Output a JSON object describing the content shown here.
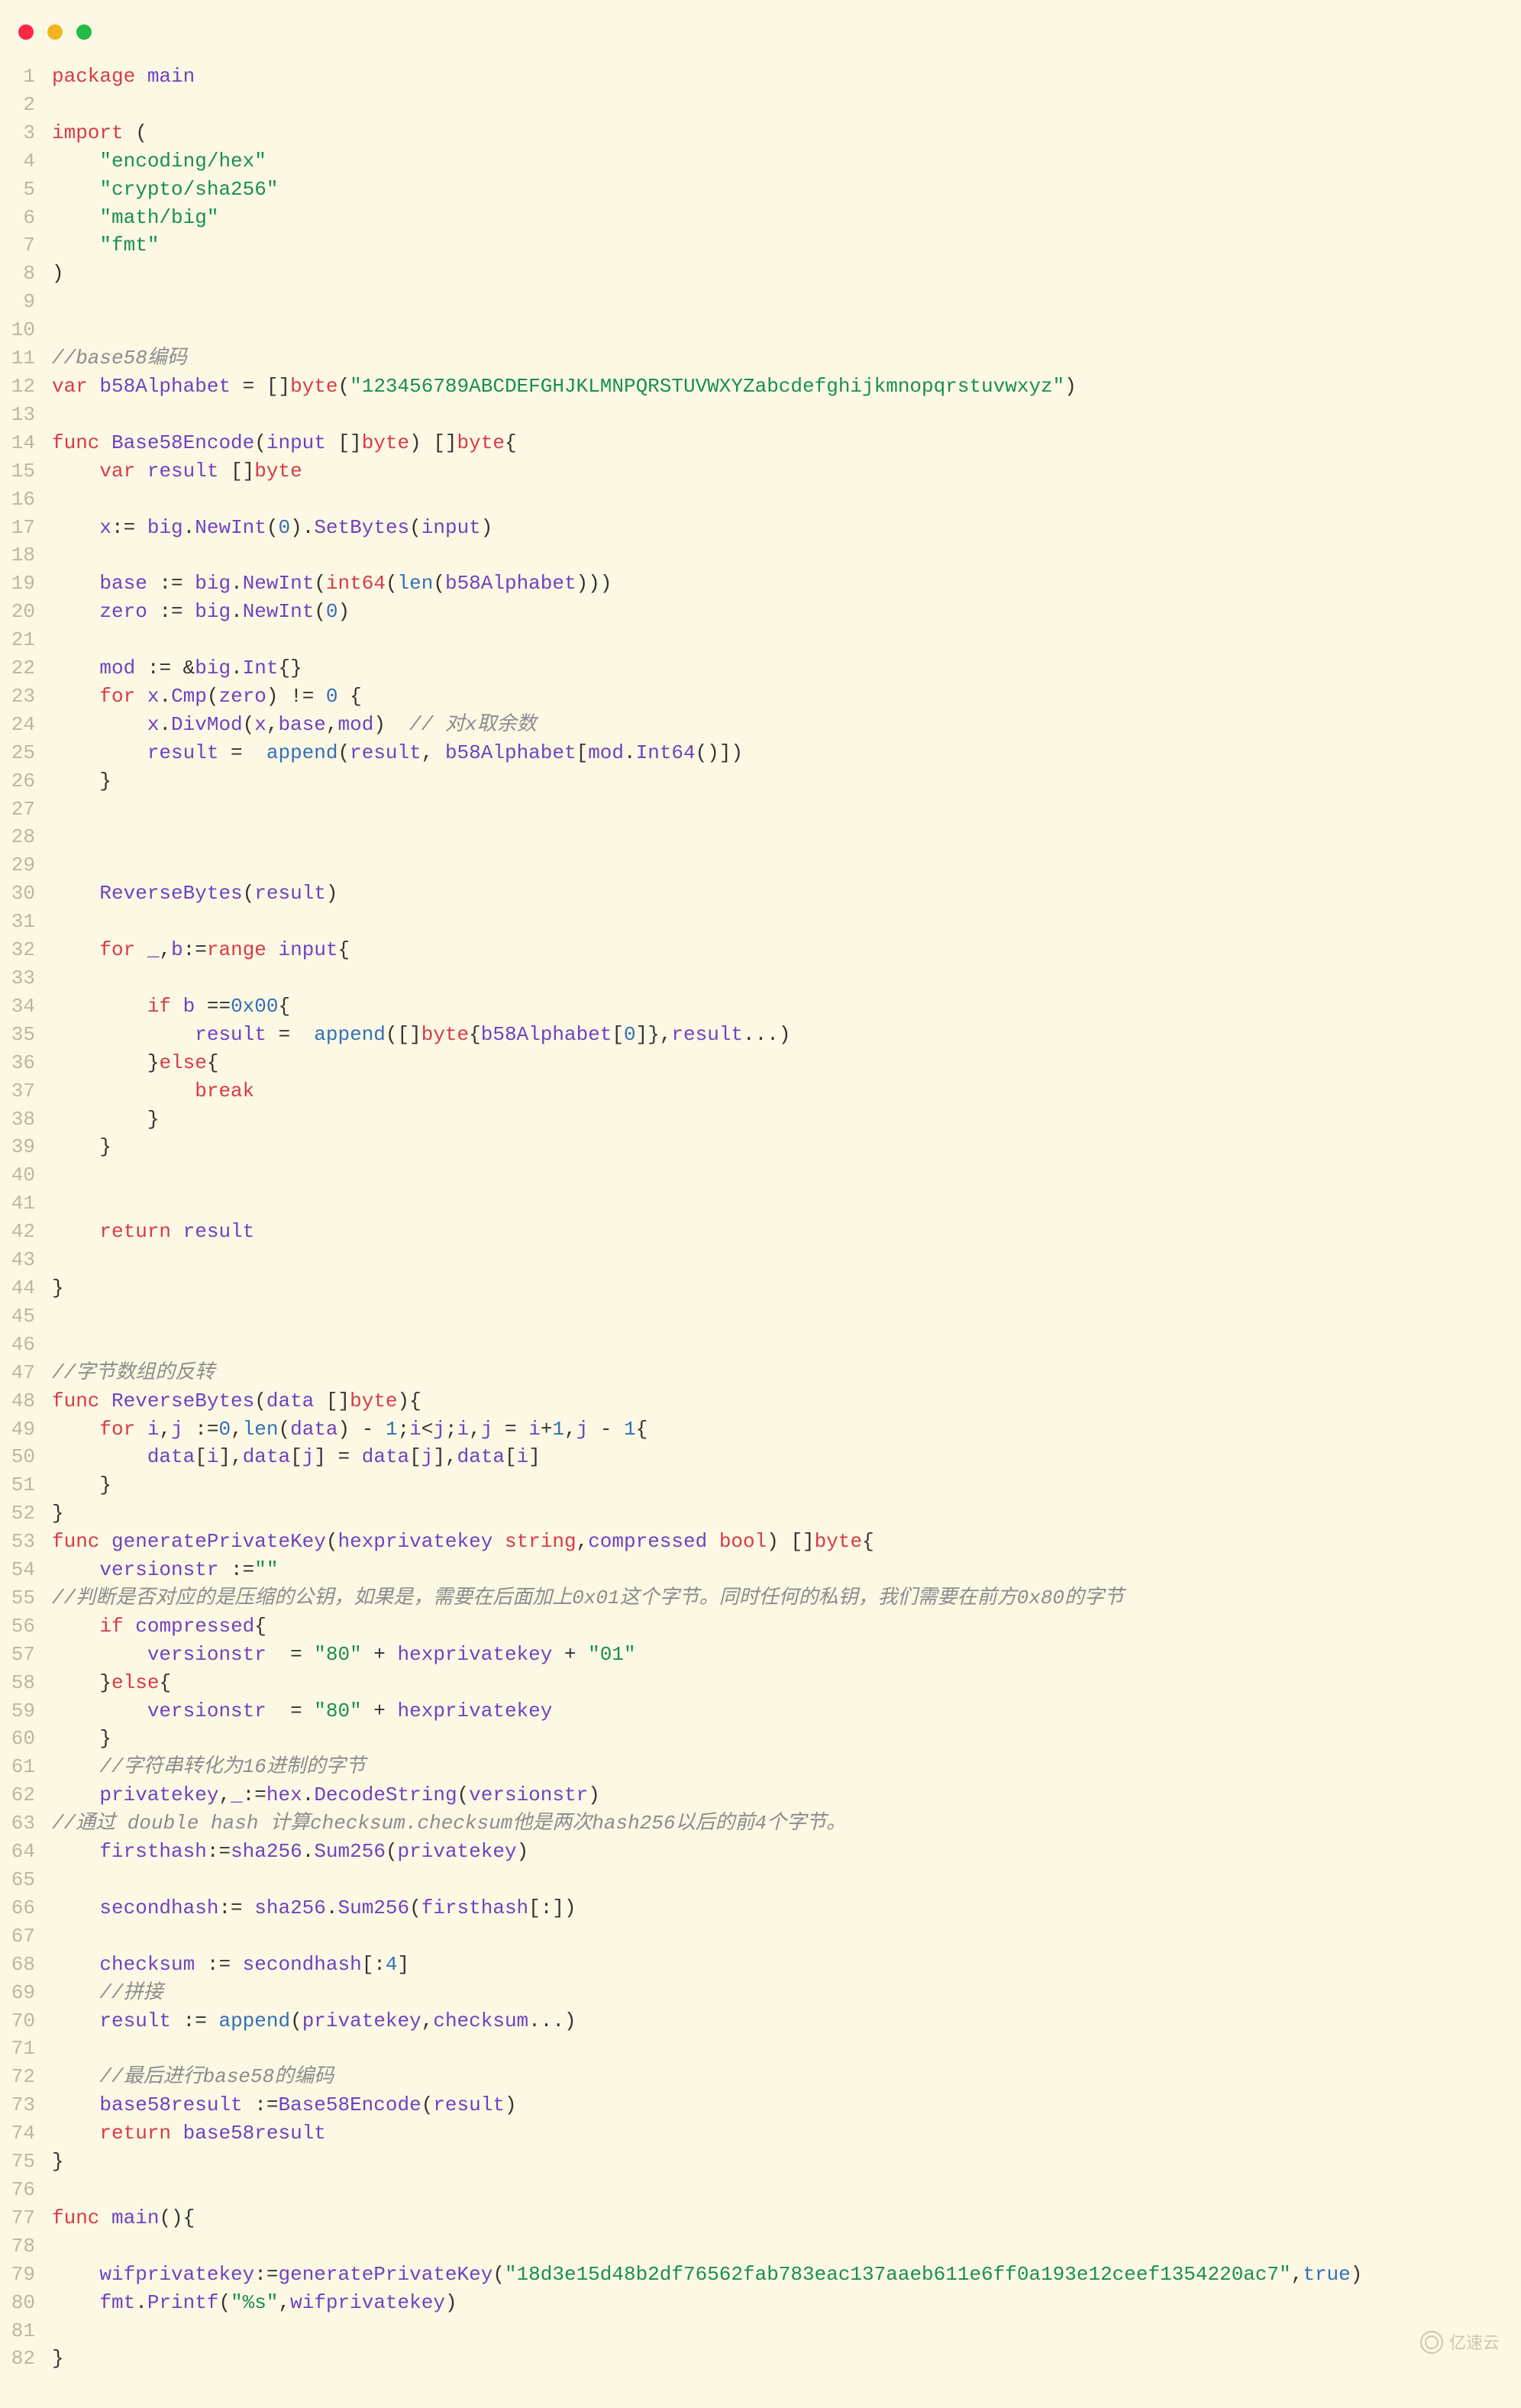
{
  "watermark": "亿速云",
  "lines": [
    {
      "n": 1,
      "h": "<span class='kw'>package</span> <span class='id'>main</span>"
    },
    {
      "n": 2,
      "h": ""
    },
    {
      "n": 3,
      "h": "<span class='kw'>import</span> ("
    },
    {
      "n": 4,
      "h": "    <span class='str'>\"encoding/hex\"</span>"
    },
    {
      "n": 5,
      "h": "    <span class='str'>\"crypto/sha256\"</span>"
    },
    {
      "n": 6,
      "h": "    <span class='str'>\"math/big\"</span>"
    },
    {
      "n": 7,
      "h": "    <span class='str'>\"fmt\"</span>"
    },
    {
      "n": 8,
      "h": ")"
    },
    {
      "n": 9,
      "h": ""
    },
    {
      "n": 10,
      "h": ""
    },
    {
      "n": 11,
      "h": "<span class='cm'>//base58编码</span>"
    },
    {
      "n": 12,
      "h": "<span class='kw'>var</span> <span class='id'>b58Alphabet</span> = []<span class='kw'>byte</span>(<span class='str'>\"123456789ABCDEFGHJKLMNPQRSTUVWXYZabcdefghijkmnopqrstuvwxyz\"</span>)"
    },
    {
      "n": 13,
      "h": ""
    },
    {
      "n": 14,
      "h": "<span class='kw'>func</span> <span class='id'>Base58Encode</span>(<span class='id'>input</span> []<span class='kw'>byte</span>) []<span class='kw'>byte</span>{"
    },
    {
      "n": 15,
      "h": "    <span class='kw'>var</span> <span class='id'>result</span> []<span class='kw'>byte</span>"
    },
    {
      "n": 16,
      "h": ""
    },
    {
      "n": 17,
      "h": "    <span class='id'>x</span>:= <span class='id'>big</span>.<span class='id'>NewInt</span>(<span class='num'>0</span>).<span class='id'>SetBytes</span>(<span class='id'>input</span>)"
    },
    {
      "n": 18,
      "h": ""
    },
    {
      "n": 19,
      "h": "    <span class='id'>base</span> := <span class='id'>big</span>.<span class='id'>NewInt</span>(<span class='kw'>int64</span>(<span class='bl'>len</span>(<span class='id'>b58Alphabet</span>)))"
    },
    {
      "n": 20,
      "h": "    <span class='id'>zero</span> := <span class='id'>big</span>.<span class='id'>NewInt</span>(<span class='num'>0</span>)"
    },
    {
      "n": 21,
      "h": ""
    },
    {
      "n": 22,
      "h": "    <span class='id'>mod</span> := &amp;<span class='id'>big</span>.<span class='id'>Int</span>{}"
    },
    {
      "n": 23,
      "h": "    <span class='kw'>for</span> <span class='id'>x</span>.<span class='id'>Cmp</span>(<span class='id'>zero</span>) != <span class='num'>0</span> {"
    },
    {
      "n": 24,
      "h": "        <span class='id'>x</span>.<span class='id'>DivMod</span>(<span class='id'>x</span>,<span class='id'>base</span>,<span class='id'>mod</span>)  <span class='cm'>// 对x取余数</span>"
    },
    {
      "n": 25,
      "h": "        <span class='id'>result</span> =  <span class='bl'>append</span>(<span class='id'>result</span>, <span class='id'>b58Alphabet</span>[<span class='id'>mod</span>.<span class='id'>Int64</span>()])"
    },
    {
      "n": 26,
      "h": "    }"
    },
    {
      "n": 27,
      "h": ""
    },
    {
      "n": 28,
      "h": ""
    },
    {
      "n": 29,
      "h": ""
    },
    {
      "n": 30,
      "h": "    <span class='id'>ReverseBytes</span>(<span class='id'>result</span>)"
    },
    {
      "n": 31,
      "h": ""
    },
    {
      "n": 32,
      "h": "    <span class='kw'>for</span> <span class='id'>_</span>,<span class='id'>b</span>:=<span class='kw'>range</span> <span class='id'>input</span>{"
    },
    {
      "n": 33,
      "h": ""
    },
    {
      "n": 34,
      "h": "        <span class='kw'>if</span> <span class='id'>b</span> ==<span class='num'>0x00</span>{"
    },
    {
      "n": 35,
      "h": "            <span class='id'>result</span> =  <span class='bl'>append</span>([]<span class='kw'>byte</span>{<span class='id'>b58Alphabet</span>[<span class='num'>0</span>]},<span class='id'>result</span>...)"
    },
    {
      "n": 36,
      "h": "        }<span class='kw'>else</span>{"
    },
    {
      "n": 37,
      "h": "            <span class='kw'>break</span>"
    },
    {
      "n": 38,
      "h": "        }"
    },
    {
      "n": 39,
      "h": "    }"
    },
    {
      "n": 40,
      "h": ""
    },
    {
      "n": 41,
      "h": ""
    },
    {
      "n": 42,
      "h": "    <span class='kw'>return</span> <span class='id'>result</span>"
    },
    {
      "n": 43,
      "h": ""
    },
    {
      "n": 44,
      "h": "}"
    },
    {
      "n": 45,
      "h": ""
    },
    {
      "n": 46,
      "h": ""
    },
    {
      "n": 47,
      "h": "<span class='cm'>//字节数组的反转</span>"
    },
    {
      "n": 48,
      "h": "<span class='kw'>func</span> <span class='id'>ReverseBytes</span>(<span class='id'>data</span> []<span class='kw'>byte</span>){"
    },
    {
      "n": 49,
      "h": "    <span class='kw'>for</span> <span class='id'>i</span>,<span class='id'>j</span> :=<span class='num'>0</span>,<span class='bl'>len</span>(<span class='id'>data</span>) - <span class='num'>1</span>;<span class='id'>i</span>&lt;<span class='id'>j</span>;<span class='id'>i</span>,<span class='id'>j</span> = <span class='id'>i</span>+<span class='num'>1</span>,<span class='id'>j</span> - <span class='num'>1</span>{"
    },
    {
      "n": 50,
      "h": "        <span class='id'>data</span>[<span class='id'>i</span>],<span class='id'>data</span>[<span class='id'>j</span>] = <span class='id'>data</span>[<span class='id'>j</span>],<span class='id'>data</span>[<span class='id'>i</span>]"
    },
    {
      "n": 51,
      "h": "    }"
    },
    {
      "n": 52,
      "h": "}"
    },
    {
      "n": 53,
      "h": "<span class='kw'>func</span> <span class='id'>generatePrivateKey</span>(<span class='id'>hexprivatekey</span> <span class='kw'>string</span>,<span class='id'>compressed</span> <span class='kw'>bool</span>) []<span class='kw'>byte</span>{"
    },
    {
      "n": 54,
      "h": "    <span class='id'>versionstr</span> :=<span class='str'>\"\"</span>"
    },
    {
      "n": 55,
      "h": "<span class='cm'>//判断是否对应的是压缩的公钥，如果是，需要在后面加上0x01这个字节。同时任何的私钥，我们需要在前方0x80的字节</span>"
    },
    {
      "n": 56,
      "h": "    <span class='kw'>if</span> <span class='id'>compressed</span>{"
    },
    {
      "n": 57,
      "h": "        <span class='id'>versionstr</span>  = <span class='str'>\"80\"</span> + <span class='id'>hexprivatekey</span> + <span class='str'>\"01\"</span>"
    },
    {
      "n": 58,
      "h": "    }<span class='kw'>else</span>{"
    },
    {
      "n": 59,
      "h": "        <span class='id'>versionstr</span>  = <span class='str'>\"80\"</span> + <span class='id'>hexprivatekey</span>"
    },
    {
      "n": 60,
      "h": "    }"
    },
    {
      "n": 61,
      "h": "    <span class='cm'>//字符串转化为16进制的字节</span>"
    },
    {
      "n": 62,
      "h": "    <span class='id'>privatekey</span>,<span class='id'>_</span>:=<span class='id'>hex</span>.<span class='id'>DecodeString</span>(<span class='id'>versionstr</span>)"
    },
    {
      "n": 63,
      "h": "<span class='cm'>//通过 double hash 计算checksum.checksum他是两次hash256以后的前4个字节。</span>"
    },
    {
      "n": 64,
      "h": "    <span class='id'>firsthash</span>:=<span class='id'>sha256</span>.<span class='id'>Sum256</span>(<span class='id'>privatekey</span>)"
    },
    {
      "n": 65,
      "h": ""
    },
    {
      "n": 66,
      "h": "    <span class='id'>secondhash</span>:= <span class='id'>sha256</span>.<span class='id'>Sum256</span>(<span class='id'>firsthash</span>[:])"
    },
    {
      "n": 67,
      "h": ""
    },
    {
      "n": 68,
      "h": "    <span class='id'>checksum</span> := <span class='id'>secondhash</span>[:<span class='num'>4</span>]"
    },
    {
      "n": 69,
      "h": "    <span class='cm'>//拼接</span>"
    },
    {
      "n": 70,
      "h": "    <span class='id'>result</span> := <span class='bl'>append</span>(<span class='id'>privatekey</span>,<span class='id'>checksum</span>...)"
    },
    {
      "n": 71,
      "h": ""
    },
    {
      "n": 72,
      "h": "    <span class='cm'>//最后进行base58的编码</span>"
    },
    {
      "n": 73,
      "h": "    <span class='id'>base58result</span> :=<span class='id'>Base58Encode</span>(<span class='id'>result</span>)"
    },
    {
      "n": 74,
      "h": "    <span class='kw'>return</span> <span class='id'>base58result</span>"
    },
    {
      "n": 75,
      "h": "}"
    },
    {
      "n": 76,
      "h": ""
    },
    {
      "n": 77,
      "h": "<span class='kw'>func</span> <span class='id'>main</span>(){"
    },
    {
      "n": 78,
      "h": ""
    },
    {
      "n": 79,
      "h": "    <span class='id'>wifprivatekey</span>:=<span class='id'>generatePrivateKey</span>(<span class='str'>\"18d3e15d48b2df76562fab783eac137aaeb611e6ff0a193e12ceef1354220ac7\"</span>,<span class='num'>true</span>)"
    },
    {
      "n": 80,
      "h": "    <span class='id'>fmt</span>.<span class='id'>Printf</span>(<span class='str'>\"%s\"</span>,<span class='id'>wifprivatekey</span>)"
    },
    {
      "n": 81,
      "h": ""
    },
    {
      "n": 82,
      "h": "}"
    }
  ]
}
